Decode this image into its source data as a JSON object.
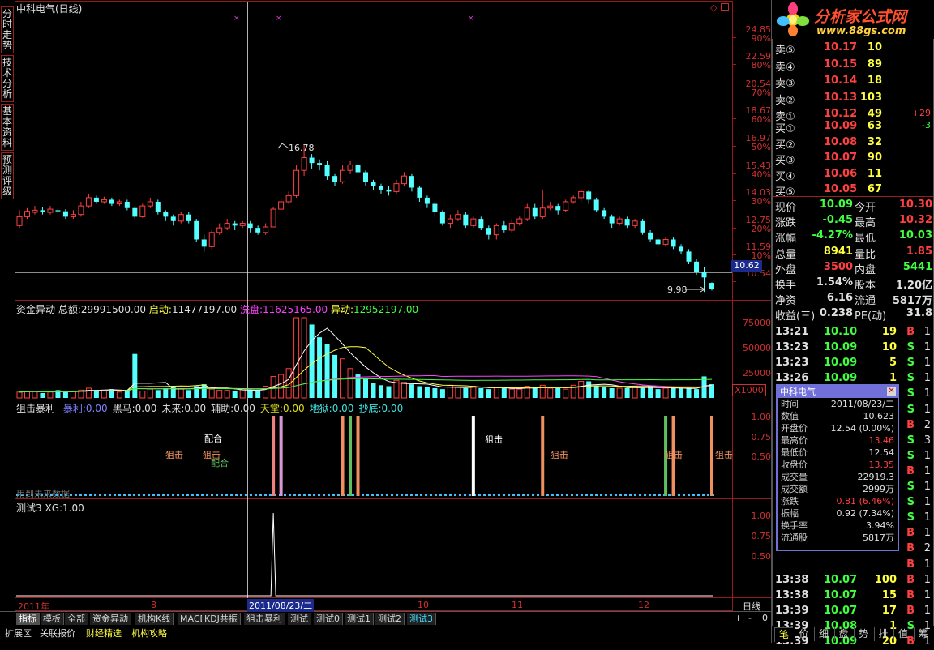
{
  "stock_title": "中科电气(日线)",
  "left_tabs": [
    "分时走势",
    "技术分析",
    "基本资料",
    "预测评级"
  ],
  "price_axis": [
    {
      "price": "24.85",
      "pct": "90%"
    },
    {
      "price": "22.59",
      "pct": "80%"
    },
    {
      "price": "20.54",
      "pct": "70%"
    },
    {
      "price": "18.67",
      "pct": "60%"
    },
    {
      "price": "16.97",
      "pct": "50%"
    },
    {
      "price": "15.43",
      "pct": "40%"
    },
    {
      "price": "14.03",
      "pct": "30%"
    },
    {
      "price": "12.75",
      "pct": "20%"
    },
    {
      "price": "11.59",
      "pct": "10%"
    },
    {
      "price": "10.54",
      "pct": ""
    }
  ],
  "crosshair_price": "10.62",
  "high_label": "16.78",
  "low_label": "9.98",
  "fund_panel": {
    "name": "资金异动",
    "total_label": "总额:",
    "total": "29991500.00",
    "start_label": "启动:",
    "start": "11477197.00",
    "wash_label": "洗盘:",
    "wash": "11625165.00",
    "move_label": "异动:",
    "move": "12952197.00",
    "axis": [
      "75000",
      "50000",
      "25000"
    ],
    "unit": "X1000"
  },
  "snipe_panel": {
    "name": "狙击暴利",
    "items": [
      {
        "label": "暴利:",
        "value": "0.00",
        "color": "#8080ff"
      },
      {
        "label": "黑马:",
        "value": "0.00",
        "color": "#e0e0e0"
      },
      {
        "label": "未来:",
        "value": "0.00",
        "color": "#e0e0e0"
      },
      {
        "label": "辅助:",
        "value": "0.00",
        "color": "#e0e0e0"
      },
      {
        "label": "天堂:",
        "value": "0.00",
        "color": "#e0e020"
      },
      {
        "label": "地狱:",
        "value": "0.00",
        "color": "#40e0e0"
      },
      {
        "label": "抄底:",
        "value": "0.00",
        "color": "#40e0e0"
      }
    ],
    "axis": [
      "1.00",
      "0.75",
      "0.50"
    ],
    "note": "用到未来数据",
    "tags": [
      "狙击",
      "配合",
      "狙击",
      "配合",
      "狙击",
      "狙击",
      "狙击",
      "狙击"
    ]
  },
  "test_panel": {
    "name": "测试3",
    "xg_label": "XG:",
    "xg": "1.00",
    "axis": [
      "1.00",
      "0.75",
      "0.50"
    ]
  },
  "date_axis": {
    "year": "2011年",
    "m8": "8",
    "current": "2011/08/23/二",
    "m10": "10",
    "m11": "11",
    "m12": "12",
    "period": "日线"
  },
  "bottom_tabs": [
    "指标",
    "模板",
    "全部",
    "资金异动",
    "机构K线",
    "MACD",
    "KDJ共振",
    "狙击暴利",
    "测试",
    "测试0",
    "测试1",
    "测试2",
    "测试3"
  ],
  "bottom_tabs2": [
    "扩展区",
    "关联报价",
    "财经精选",
    "机构攻略"
  ],
  "right_tabs": [
    "笔",
    "价",
    "细",
    "盘",
    "势",
    "排",
    "值",
    "筹"
  ],
  "logo": {
    "title": "分析家公式网",
    "url": "www.88gs.com"
  },
  "order_book": {
    "asks": [
      {
        "label": "卖⑤",
        "price": "10.17",
        "vol": "10",
        "chg": ""
      },
      {
        "label": "卖④",
        "price": "10.15",
        "vol": "89",
        "chg": ""
      },
      {
        "label": "卖③",
        "price": "10.14",
        "vol": "18",
        "chg": ""
      },
      {
        "label": "卖②",
        "price": "10.13",
        "vol": "103",
        "chg": ""
      },
      {
        "label": "卖①",
        "price": "10.12",
        "vol": "49",
        "chg": "+29"
      }
    ],
    "bids": [
      {
        "label": "买①",
        "price": "10.09",
        "vol": "63",
        "chg": "-3"
      },
      {
        "label": "买②",
        "price": "10.08",
        "vol": "32",
        "chg": ""
      },
      {
        "label": "买③",
        "price": "10.07",
        "vol": "90",
        "chg": ""
      },
      {
        "label": "买④",
        "price": "10.06",
        "vol": "11",
        "chg": ""
      },
      {
        "label": "买⑤",
        "price": "10.05",
        "vol": "67",
        "chg": ""
      }
    ]
  },
  "quote": [
    {
      "l1": "现价",
      "v1": "10.09",
      "l2": "今开",
      "v2": "10.30"
    },
    {
      "l1": "涨跌",
      "v1": "-0.45",
      "l2": "最高",
      "v2": "10.32"
    },
    {
      "l1": "涨幅",
      "v1": "-4.27%",
      "l2": "最低",
      "v2": "10.03"
    },
    {
      "l1": "总量",
      "v1": "8941",
      "l2": "量比",
      "v2": "1.85"
    },
    {
      "l1": "外盘",
      "v1": "3500",
      "l2": "内盘",
      "v2": "5441"
    },
    {
      "l1": "换手",
      "v1": "1.54%",
      "l2": "股本",
      "v2": "1.20亿"
    },
    {
      "l1": "净资",
      "v1": "6.16",
      "l2": "流通",
      "v2": "5817万"
    },
    {
      "l1": "收益(三)",
      "v1": "0.238",
      "l2": "PE(动)",
      "v2": "31.8"
    }
  ],
  "ticks": [
    {
      "time": "13:21",
      "price": "10.10",
      "vol": "19",
      "bs": "B",
      "n": "1"
    },
    {
      "time": "13:23",
      "price": "10.09",
      "vol": "10",
      "bs": "S",
      "n": "1"
    },
    {
      "time": "13:23",
      "price": "10.09",
      "vol": "5",
      "bs": "S",
      "n": "1"
    },
    {
      "time": "13:26",
      "price": "10.09",
      "vol": "1",
      "bs": "S",
      "n": "1"
    },
    {
      "time": "",
      "price": "",
      "vol": "",
      "bs": "S",
      "n": "1"
    },
    {
      "time": "",
      "price": "",
      "vol": "",
      "bs": "S",
      "n": "1"
    },
    {
      "time": "",
      "price": "",
      "vol": "",
      "bs": "B",
      "n": "2"
    },
    {
      "time": "",
      "price": "",
      "vol": "",
      "bs": "S",
      "n": "3"
    },
    {
      "time": "",
      "price": "",
      "vol": "",
      "bs": "S",
      "n": "1"
    },
    {
      "time": "",
      "price": "",
      "vol": "",
      "bs": "B",
      "n": "1"
    },
    {
      "time": "",
      "price": "",
      "vol": "",
      "bs": "S",
      "n": "1"
    },
    {
      "time": "",
      "price": "",
      "vol": "",
      "bs": "S",
      "n": "1"
    },
    {
      "time": "",
      "price": "",
      "vol": "",
      "bs": "S",
      "n": "1"
    },
    {
      "time": "",
      "price": "",
      "vol": "",
      "bs": "B",
      "n": "1"
    },
    {
      "time": "",
      "price": "",
      "vol": "",
      "bs": "B",
      "n": "2"
    },
    {
      "time": "",
      "price": "",
      "vol": "",
      "bs": "B",
      "n": "1"
    },
    {
      "time": "13:38",
      "price": "10.07",
      "vol": "100",
      "bs": "B",
      "n": "1"
    },
    {
      "time": "13:38",
      "price": "10.07",
      "vol": "15",
      "bs": "B",
      "n": "1"
    },
    {
      "time": "13:39",
      "price": "10.07",
      "vol": "17",
      "bs": "B",
      "n": "1"
    },
    {
      "time": "13:39",
      "price": "10.08",
      "vol": "1",
      "bs": "S",
      "n": "1"
    },
    {
      "time": "13:39",
      "price": "10.09",
      "vol": "20",
      "bs": "B",
      "n": "1"
    }
  ],
  "popup": {
    "title": "中科电气",
    "rows": [
      {
        "label": "时间",
        "value": "2011/08/23/二",
        "color": "#e0e0e0"
      },
      {
        "label": "数值",
        "value": "10.623",
        "color": "#e0e0e0"
      },
      {
        "label": "开盘价",
        "value": "12.54 (0.00%)",
        "color": "#e0e0e0"
      },
      {
        "label": "最高价",
        "value": "13.46",
        "color": "#ff4040"
      },
      {
        "label": "最低价",
        "value": "12.54",
        "color": "#e0e0e0"
      },
      {
        "label": "收盘价",
        "value": "13.35",
        "color": "#ff4040"
      },
      {
        "label": "成交量",
        "value": "22919.3",
        "color": "#e0e0e0"
      },
      {
        "label": "成交额",
        "value": "2999万",
        "color": "#e0e0e0"
      },
      {
        "label": "涨跌",
        "value": "0.81 (6.46%)",
        "color": "#ff4040"
      },
      {
        "label": "振幅",
        "value": "0.92 (7.34%)",
        "color": "#e0e0e0"
      },
      {
        "label": "换手率",
        "value": "3.94%",
        "color": "#e0e0e0"
      },
      {
        "label": "流通股",
        "value": "5817万",
        "color": "#e0e0e0"
      }
    ]
  },
  "colors": {
    "up": "#ff4040",
    "down": "#54ffff",
    "grid": "#9a1818",
    "label_red": "#d03030",
    "green": "#00ff00",
    "yellow": "#ffff40"
  },
  "chart_data": {
    "type": "candlestick",
    "candles": [
      [
        12.6,
        13.0,
        13.3,
        12.5
      ],
      [
        13.0,
        13.25,
        13.4,
        12.9
      ],
      [
        13.2,
        13.3,
        13.5,
        13.1
      ],
      [
        13.3,
        13.2,
        13.45,
        13.1
      ],
      [
        13.2,
        13.35,
        13.5,
        13.1
      ],
      [
        13.3,
        13.25,
        13.4,
        13.15
      ],
      [
        13.25,
        13.0,
        13.35,
        12.9
      ],
      [
        13.0,
        13.1,
        13.3,
        12.9
      ],
      [
        13.1,
        13.5,
        13.7,
        13.0
      ],
      [
        13.5,
        13.9,
        14.1,
        13.4
      ],
      [
        13.9,
        13.7,
        14.0,
        13.6
      ],
      [
        13.7,
        13.8,
        13.95,
        13.6
      ],
      [
        13.8,
        13.6,
        13.9,
        13.5
      ],
      [
        13.6,
        13.7,
        13.8,
        13.5
      ],
      [
        13.7,
        13.4,
        13.8,
        13.3
      ],
      [
        13.4,
        13.0,
        13.5,
        12.9
      ],
      [
        13.0,
        13.5,
        13.6,
        12.95
      ],
      [
        13.5,
        13.7,
        13.9,
        13.4
      ],
      [
        13.7,
        13.2,
        13.8,
        13.1
      ],
      [
        13.2,
        13.0,
        13.3,
        12.8
      ],
      [
        13.0,
        12.8,
        13.1,
        12.6
      ],
      [
        12.8,
        13.1,
        13.2,
        12.7
      ],
      [
        13.1,
        12.8,
        13.2,
        12.7
      ],
      [
        12.8,
        12.0,
        12.9,
        11.9
      ],
      [
        12.0,
        11.7,
        12.2,
        11.5
      ],
      [
        11.7,
        12.3,
        12.4,
        11.6
      ],
      [
        12.3,
        12.5,
        12.7,
        12.2
      ],
      [
        12.5,
        12.7,
        12.9,
        12.4
      ],
      [
        12.7,
        12.6,
        12.8,
        12.4
      ],
      [
        12.6,
        12.7,
        12.8,
        12.5
      ],
      [
        12.7,
        12.5,
        12.8,
        12.3
      ],
      [
        12.5,
        12.3,
        12.6,
        12.2
      ],
      [
        12.3,
        12.54,
        12.7,
        12.2
      ],
      [
        12.54,
        13.35,
        13.46,
        12.54
      ],
      [
        13.35,
        13.7,
        13.9,
        13.3
      ],
      [
        13.7,
        14.0,
        14.2,
        13.6
      ],
      [
        14.0,
        15.3,
        15.6,
        13.9
      ],
      [
        15.3,
        16.0,
        16.78,
        15.0
      ],
      [
        16.0,
        15.7,
        16.2,
        15.4
      ],
      [
        15.7,
        15.6,
        15.9,
        15.3
      ],
      [
        15.6,
        15.0,
        15.8,
        14.8
      ],
      [
        15.0,
        14.7,
        15.1,
        14.5
      ],
      [
        14.7,
        15.3,
        15.6,
        14.6
      ],
      [
        15.3,
        15.6,
        15.8,
        15.1
      ],
      [
        15.6,
        15.2,
        15.7,
        15.0
      ],
      [
        15.2,
        14.7,
        15.3,
        14.5
      ],
      [
        14.7,
        14.5,
        14.8,
        14.3
      ],
      [
        14.5,
        14.3,
        14.6,
        14.1
      ],
      [
        14.3,
        14.2,
        14.5,
        14.0
      ],
      [
        14.2,
        14.6,
        14.8,
        14.1
      ],
      [
        14.6,
        15.0,
        15.2,
        14.5
      ],
      [
        15.0,
        14.4,
        15.1,
        14.2
      ],
      [
        14.4,
        13.9,
        14.5,
        13.7
      ],
      [
        13.9,
        13.6,
        14.0,
        13.4
      ],
      [
        13.6,
        13.2,
        13.7,
        13.0
      ],
      [
        13.2,
        12.7,
        13.3,
        12.6
      ],
      [
        12.7,
        12.9,
        13.1,
        12.5
      ],
      [
        12.9,
        13.1,
        13.3,
        12.8
      ],
      [
        13.1,
        12.6,
        13.2,
        12.5
      ],
      [
        12.6,
        12.9,
        13.0,
        12.5
      ],
      [
        12.9,
        12.5,
        13.0,
        12.4
      ],
      [
        12.5,
        12.2,
        12.6,
        12.0
      ],
      [
        12.2,
        12.6,
        12.7,
        12.0
      ],
      [
        12.6,
        12.4,
        12.8,
        12.3
      ],
      [
        12.4,
        12.7,
        12.9,
        12.3
      ],
      [
        12.7,
        12.9,
        13.0,
        12.6
      ],
      [
        12.9,
        13.4,
        13.6,
        12.8
      ],
      [
        13.4,
        13.0,
        13.6,
        12.9
      ],
      [
        13.0,
        13.4,
        14.3,
        12.9
      ],
      [
        13.4,
        13.5,
        13.7,
        13.3
      ],
      [
        13.5,
        13.3,
        13.6,
        13.1
      ],
      [
        13.3,
        13.7,
        13.8,
        13.2
      ],
      [
        13.7,
        13.9,
        14.0,
        13.6
      ],
      [
        13.9,
        14.2,
        14.3,
        13.7
      ],
      [
        14.2,
        13.8,
        14.3,
        13.6
      ],
      [
        13.8,
        13.3,
        13.9,
        13.2
      ],
      [
        13.3,
        13.0,
        13.4,
        12.9
      ],
      [
        13.0,
        12.7,
        13.1,
        12.5
      ],
      [
        12.7,
        12.9,
        13.0,
        12.6
      ],
      [
        12.9,
        12.6,
        13.0,
        12.5
      ],
      [
        12.6,
        12.8,
        12.9,
        12.5
      ],
      [
        12.8,
        12.3,
        12.9,
        12.2
      ],
      [
        12.3,
        12.0,
        12.4,
        11.9
      ],
      [
        12.0,
        11.8,
        12.1,
        11.7
      ],
      [
        11.8,
        12.0,
        12.1,
        11.7
      ],
      [
        12.0,
        11.7,
        12.1,
        11.6
      ],
      [
        11.7,
        11.5,
        11.8,
        11.4
      ],
      [
        11.5,
        11.1,
        11.6,
        11.0
      ],
      [
        11.1,
        10.7,
        11.2,
        10.6
      ],
      [
        10.7,
        10.5,
        10.9,
        9.98
      ],
      [
        10.3,
        10.09,
        10.32,
        10.03
      ]
    ],
    "volume": [
      6,
      7,
      7,
      5,
      6,
      8,
      6,
      7,
      8,
      10,
      8,
      7,
      9,
      6,
      8,
      45,
      7,
      9,
      8,
      10,
      11,
      9,
      8,
      12,
      14,
      9,
      8,
      8,
      7,
      9,
      8,
      7,
      12,
      22,
      24,
      30,
      82,
      82,
      75,
      62,
      55,
      44,
      40,
      30,
      24,
      20,
      15,
      13,
      12,
      18,
      16,
      14,
      12,
      11,
      10,
      9,
      13,
      11,
      10,
      12,
      10,
      9,
      11,
      10,
      9,
      9,
      12,
      11,
      13,
      10,
      10,
      9,
      13,
      17,
      17,
      12,
      11,
      10,
      10,
      10,
      12,
      10,
      12,
      9,
      10,
      10,
      10,
      10,
      9,
      22,
      14
    ],
    "snipe_bars": [
      {
        "idx": 33,
        "h": 0.98,
        "color": "#f08080"
      },
      {
        "idx": 34,
        "h": 0.98,
        "color": "#d898d8"
      },
      {
        "idx": 42,
        "h": 0.98,
        "color": "#f09060"
      },
      {
        "idx": 43,
        "h": 0.98,
        "color": "#60c060"
      },
      {
        "idx": 44,
        "h": 0.98,
        "color": "#f09060"
      },
      {
        "idx": 59,
        "h": 0.98,
        "color": "#ffffff"
      },
      {
        "idx": 68,
        "h": 0.98,
        "color": "#f09060"
      },
      {
        "idx": 84,
        "h": 0.98,
        "color": "#60c060"
      },
      {
        "idx": 85,
        "h": 0.98,
        "color": "#f09060"
      },
      {
        "idx": 90,
        "h": 0.98,
        "color": "#f09060"
      }
    ],
    "xg_spike_idx": 33
  }
}
